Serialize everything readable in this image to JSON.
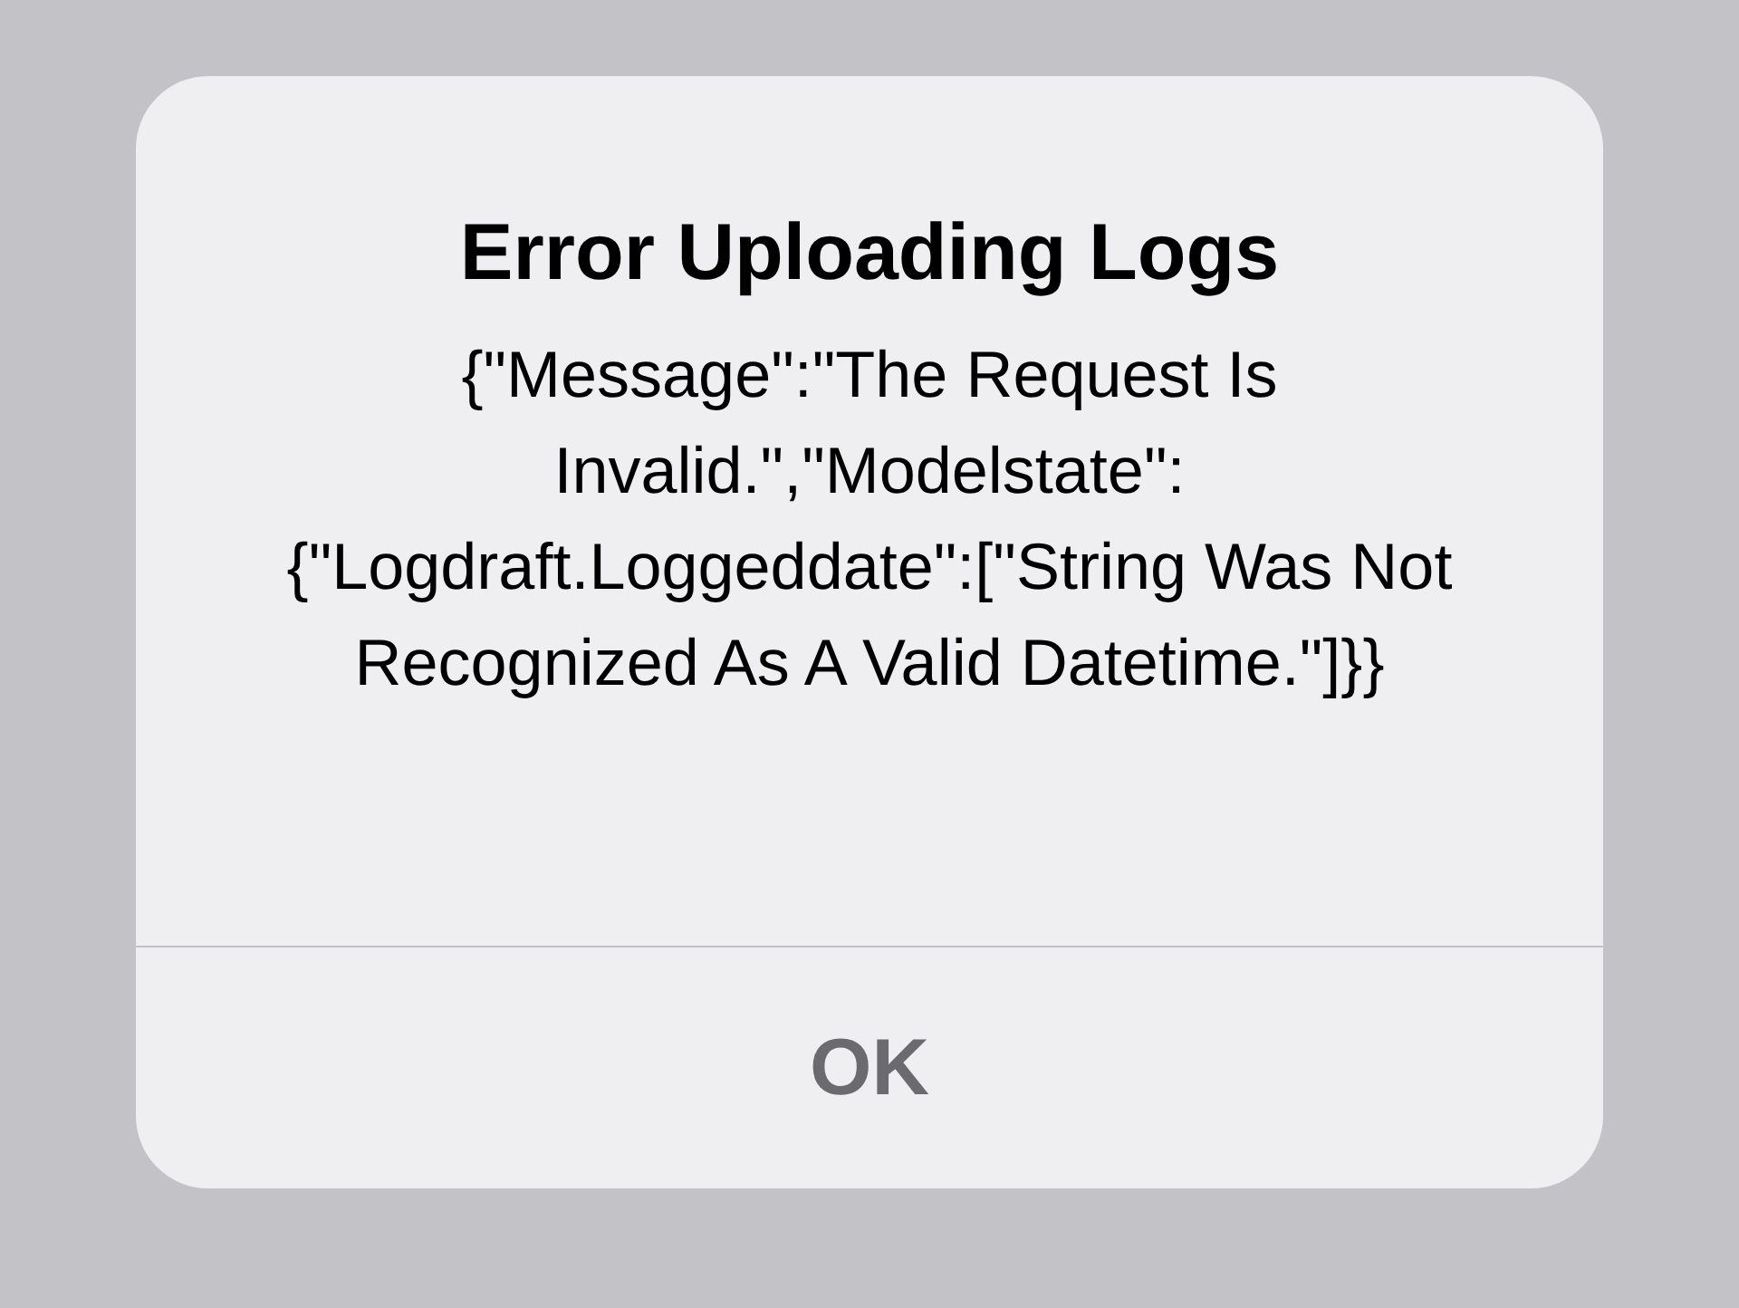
{
  "alert": {
    "title": "Error Uploading Logs",
    "message": "{\"Message\":\"The Request Is Invalid.\",\"Modelstate\":{\"Logdraft.Loggeddate\":[\"String Was Not Recognized As A Valid Datetime.\"]}}",
    "buttons": [
      {
        "label": "OK",
        "disabled": true
      }
    ]
  }
}
